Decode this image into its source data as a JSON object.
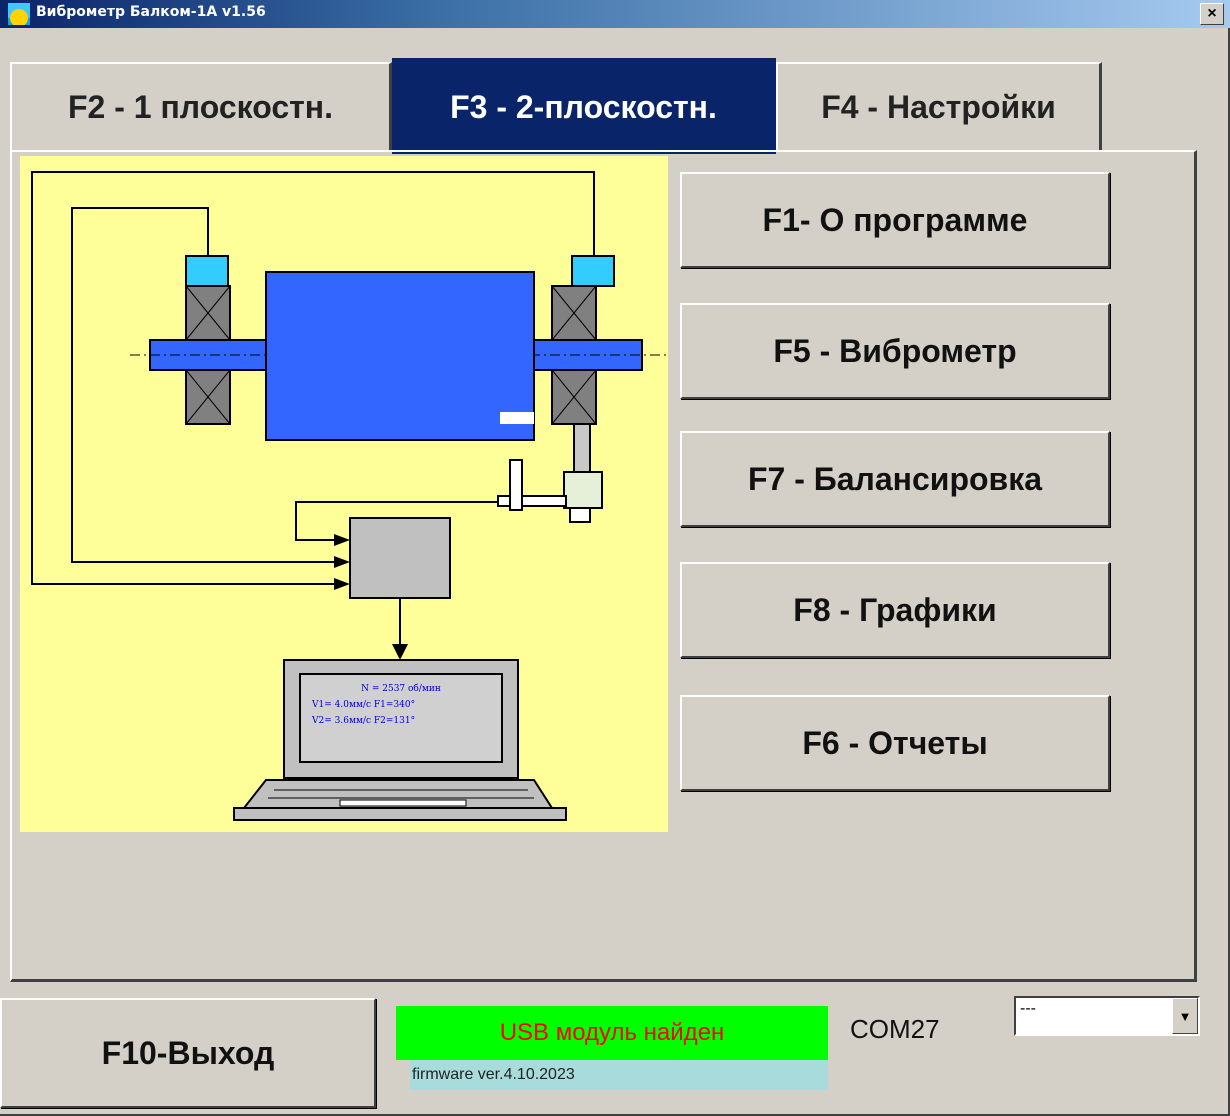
{
  "window": {
    "title": "Виброметр Балком-1А  v1.56",
    "close_symbol": "×"
  },
  "tabs": [
    {
      "label": "F2 - 1 плоскостн.",
      "active": false
    },
    {
      "label": "F3 - 2-плоскостн.",
      "active": true
    },
    {
      "label": "F4 - Настройки",
      "active": false
    }
  ],
  "menu_buttons": [
    {
      "label": "F1- О программе"
    },
    {
      "label": "F5 - Виброметр"
    },
    {
      "label": "F7 - Балансировка"
    },
    {
      "label": "F8 - Графики"
    },
    {
      "label": "F6 - Отчеты"
    }
  ],
  "diagram": {
    "screen_lines": [
      "N = 2537 об/мин",
      "V1= 4.0мм/с   F1=340°",
      "V2= 3.6мм/с   F2=131°"
    ],
    "colors": {
      "background": "#ffff99",
      "rotor": "#3366ff",
      "sensor": "#33ccff",
      "housing": "#808080",
      "unit": "#c0c0c0"
    }
  },
  "footer": {
    "exit_label": "F10-Выход",
    "status_text": "USB модуль найден",
    "firmware_text": "firmware ver.4.10.2023",
    "com_port": "COM27",
    "port_select_value": "---",
    "dropdown_symbol": "▼"
  },
  "colors": {
    "status_bg": "#00ff00",
    "status_text": "#ff0000",
    "firmware_bg": "#a8dcdc",
    "active_tab": "#0a246a"
  }
}
